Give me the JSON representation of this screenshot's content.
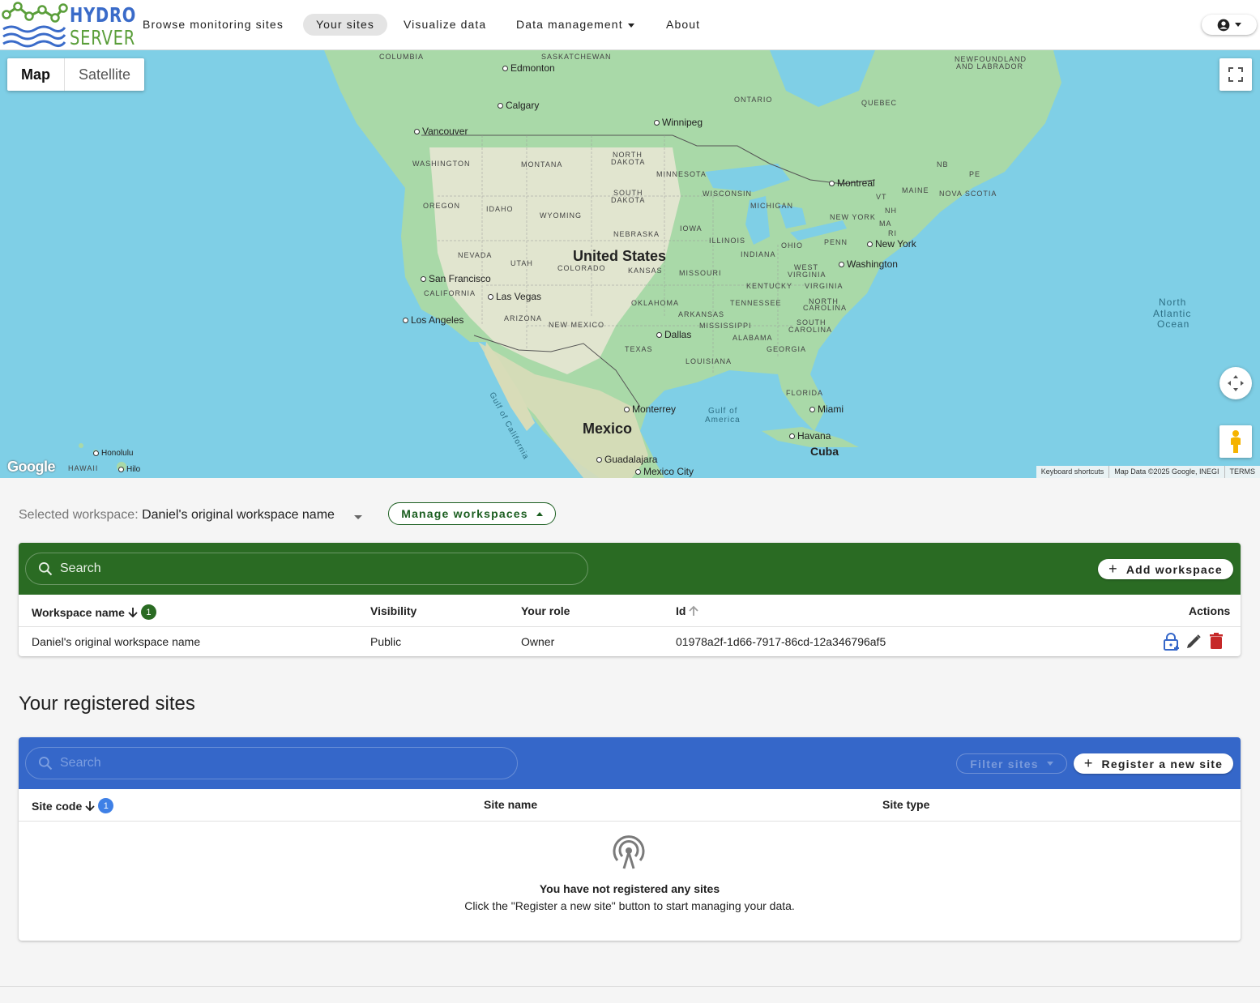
{
  "brand": {
    "line1": "HYDRO",
    "line2": "SERVER"
  },
  "nav": {
    "items": [
      {
        "label": "Browse monitoring sites"
      },
      {
        "label": "Your sites"
      },
      {
        "label": "Visualize data"
      },
      {
        "label": "Data management"
      },
      {
        "label": "About"
      }
    ]
  },
  "map": {
    "type_map": "Map",
    "type_satellite": "Satellite",
    "labels": {
      "columbia": "COLUMBIA",
      "saskatchewan": "SASKATCHEWAN",
      "newfoundland": "NEWFOUNDLAND",
      "labrador": "AND LABRADOR",
      "ontario": "ONTARIO",
      "quebec": "QUEBEC",
      "nb": "NB",
      "pe": "PE",
      "nova_scotia": "NOVA SCOTIA",
      "maine": "MAINE",
      "vt": "VT",
      "nh": "NH",
      "ma": "MA",
      "ri": "RI",
      "new_york_state": "NEW YORK",
      "penn": "PENN",
      "ohio": "OHIO",
      "michigan": "MICHIGAN",
      "wisconsin": "WISCONSIN",
      "minnesota": "MINNESOTA",
      "north_dakota_1": "NORTH",
      "north_dakota_2": "DAKOTA",
      "south_dakota_1": "SOUTH",
      "south_dakota_2": "DAKOTA",
      "montana": "MONTANA",
      "washington_state": "WASHINGTON",
      "oregon": "OREGON",
      "idaho": "IDAHO",
      "wyoming": "WYOMING",
      "nebraska": "NEBRASKA",
      "iowa": "IOWA",
      "illinois": "ILLINOIS",
      "indiana": "INDIANA",
      "nevada": "NEVADA",
      "utah": "UTAH",
      "colorado": "COLORADO",
      "kansas": "KANSAS",
      "missouri": "MISSOURI",
      "west_virginia_1": "WEST",
      "west_virginia_2": "VIRGINIA",
      "virginia": "VIRGINIA",
      "kentucky": "KENTUCKY",
      "california": "CALIFORNIA",
      "arizona": "ARIZONA",
      "new_mexico": "NEW MEXICO",
      "oklahoma": "OKLAHOMA",
      "arkansas": "ARKANSAS",
      "tennessee": "TENNESSEE",
      "north_carolina_1": "NORTH",
      "north_carolina_2": "CAROLINA",
      "south_carolina_1": "SOUTH",
      "south_carolina_2": "CAROLINA",
      "mississippi": "MISSISSIPPI",
      "alabama": "ALABAMA",
      "georgia": "GEORGIA",
      "texas": "TEXAS",
      "louisiana": "LOUISIANA",
      "florida": "FLORIDA",
      "hawaii": "HAWAII"
    },
    "cities": {
      "edmonton": "Edmonton",
      "calgary": "Calgary",
      "vancouver": "Vancouver",
      "winnipeg": "Winnipeg",
      "montreal": "Montreal",
      "new_york": "New York",
      "washington": "Washington",
      "san_francisco": "San Francisco",
      "las_vegas": "Las Vegas",
      "los_angeles": "Los Angeles",
      "dallas": "Dallas",
      "monterrey": "Monterrey",
      "miami": "Miami",
      "havana": "Havana",
      "guadalajara": "Guadalajara",
      "mexico_city": "Mexico City",
      "honolulu": "Honolulu",
      "hilo": "Hilo"
    },
    "countries": {
      "us": "United States",
      "mexico": "Mexico",
      "cuba": "Cuba"
    },
    "water": {
      "gulf_california": "Gulf of California",
      "gulf_america_1": "Gulf of",
      "gulf_america_2": "America",
      "atlantic_1": "North",
      "atlantic_2": "Atlantic",
      "atlantic_3": "Ocean"
    },
    "google_logo": "Google",
    "attribution": [
      "Keyboard shortcuts",
      "Map Data ©2025 Google, INEGI",
      "TERMS"
    ]
  },
  "workspace": {
    "selected_label": "Selected workspace:",
    "selected_value": "Daniel's original workspace name",
    "manage_label": "Manage workspaces",
    "search_placeholder": "Search",
    "add_label": "Add workspace",
    "columns": {
      "name": "Workspace name",
      "visibility": "Visibility",
      "role": "Your role",
      "id": "Id",
      "actions": "Actions"
    },
    "sort_badge": "1",
    "rows": [
      {
        "name": "Daniel's original workspace name",
        "visibility": "Public",
        "role": "Owner",
        "id": "01978a2f-1d66-7917-86cd-12a346796af5"
      }
    ]
  },
  "sites": {
    "title": "Your registered sites",
    "search_placeholder": "Search",
    "filter_label": "Filter sites",
    "register_label": "Register a new site",
    "columns": {
      "code": "Site code",
      "name": "Site name",
      "type": "Site type"
    },
    "sort_badge": "1",
    "empty_title": "You have not registered any sites",
    "empty_sub": "Click the \"Register a new site\" button to start managing your data."
  },
  "colors": {
    "green": "#2a6b23",
    "blue": "#3567c9",
    "map_water": "#7fcfe6",
    "land": "#a9d9a8"
  }
}
